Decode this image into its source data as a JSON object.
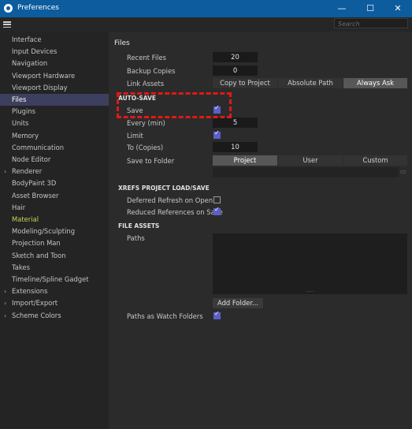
{
  "window": {
    "title": "Preferences",
    "controls": [
      "—",
      "☐",
      "✕"
    ]
  },
  "toolbar": {
    "search_placeholder": "Search"
  },
  "sidebar": {
    "items": [
      {
        "label": "Interface",
        "arrow": false,
        "state": ""
      },
      {
        "label": "Input Devices",
        "arrow": false,
        "state": ""
      },
      {
        "label": "Navigation",
        "arrow": false,
        "state": ""
      },
      {
        "label": "Viewport Hardware",
        "arrow": false,
        "state": ""
      },
      {
        "label": "Viewport Display",
        "arrow": false,
        "state": ""
      },
      {
        "label": "Files",
        "arrow": false,
        "state": "selected"
      },
      {
        "label": "Plugins",
        "arrow": false,
        "state": ""
      },
      {
        "label": "Units",
        "arrow": false,
        "state": ""
      },
      {
        "label": "Memory",
        "arrow": false,
        "state": ""
      },
      {
        "label": "Communication",
        "arrow": false,
        "state": ""
      },
      {
        "label": "Node Editor",
        "arrow": false,
        "state": ""
      },
      {
        "label": "Renderer",
        "arrow": true,
        "state": ""
      },
      {
        "label": "BodyPaint 3D",
        "arrow": false,
        "state": ""
      },
      {
        "label": "Asset Browser",
        "arrow": false,
        "state": ""
      },
      {
        "label": "Hair",
        "arrow": false,
        "state": ""
      },
      {
        "label": "Material",
        "arrow": false,
        "state": "material"
      },
      {
        "label": "Modeling/Sculpting",
        "arrow": false,
        "state": ""
      },
      {
        "label": "Projection Man",
        "arrow": false,
        "state": ""
      },
      {
        "label": "Sketch and Toon",
        "arrow": false,
        "state": ""
      },
      {
        "label": "Takes",
        "arrow": false,
        "state": ""
      },
      {
        "label": "Timeline/Spline Gadget",
        "arrow": false,
        "state": ""
      },
      {
        "label": "Extensions",
        "arrow": true,
        "state": ""
      },
      {
        "label": "Import/Export",
        "arrow": true,
        "state": ""
      },
      {
        "label": "Scheme Colors",
        "arrow": true,
        "state": ""
      }
    ]
  },
  "main": {
    "title": "Files",
    "files": {
      "recent_files_label": "Recent Files",
      "recent_files_value": "20",
      "backup_copies_label": "Backup Copies",
      "backup_copies_value": "0",
      "link_assets_label": "Link Assets",
      "link_assets_options": [
        "Copy to Project",
        "Absolute Path",
        "Always Ask"
      ],
      "link_assets_selected": "Always Ask"
    },
    "autosave": {
      "header": "AUTO-SAVE",
      "save_label": "Save",
      "save_checked": true,
      "every_label": "Every (min)",
      "every_value": "5",
      "limit_label": "Limit",
      "limit_checked": true,
      "to_label": "To (Copies)",
      "to_value": "10",
      "save_to_folder_label": "Save to Folder",
      "folder_options": [
        "Project",
        "User",
        "Custom"
      ],
      "folder_selected": "Project"
    },
    "xrefs": {
      "header": "XREFS PROJECT LOAD/SAVE",
      "deferred_label": "Deferred Refresh on Open",
      "deferred_checked": false,
      "reduced_label": "Reduced References on Save",
      "reduced_checked": true
    },
    "file_assets": {
      "header": "FILE ASSETS",
      "paths_label": "Paths",
      "add_folder_label": "Add Folder...",
      "watch_label": "Paths as Watch Folders",
      "watch_checked": true
    }
  },
  "colors": {
    "titlebar": "#0d5c9e",
    "accent": "#5b5fc8",
    "selection": "#3d3f5e",
    "highlight": "#e01818",
    "material": "#c8d25a"
  }
}
